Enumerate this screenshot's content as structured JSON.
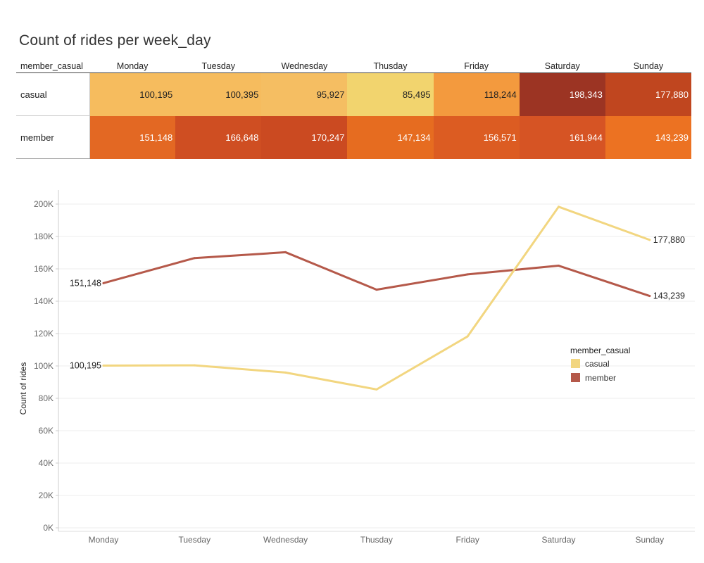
{
  "title": "Count of rides per week_day",
  "table": {
    "corner_label": "member_casual",
    "columns": [
      "Monday",
      "Tuesday",
      "Wednesday",
      "Thusday",
      "Friday",
      "Saturday",
      "Sunday"
    ],
    "rows": [
      {
        "label": "casual",
        "values": [
          "100,195",
          "100,395",
          "95,927",
          "85,495",
          "118,244",
          "198,343",
          "177,880"
        ],
        "colors": [
          "#f6bc5e",
          "#f6bc5e",
          "#f5be62",
          "#f2d46e",
          "#f39a3e",
          "#9c3423",
          "#c0461f"
        ],
        "text_colors": [
          "#222222",
          "#222222",
          "#222222",
          "#222222",
          "#222222",
          "#ffffff",
          "#ffffff"
        ]
      },
      {
        "label": "member",
        "values": [
          "151,148",
          "166,648",
          "170,247",
          "147,134",
          "156,571",
          "161,944",
          "143,239"
        ],
        "colors": [
          "#e36823",
          "#cf4e22",
          "#cb4a21",
          "#e66c20",
          "#dc5c22",
          "#d65424",
          "#ec7222"
        ],
        "text_colors": [
          "#ffffff",
          "#ffffff",
          "#ffffff",
          "#ffffff",
          "#ffffff",
          "#ffffff",
          "#ffffff"
        ]
      }
    ]
  },
  "chart_data": {
    "type": "line",
    "x": [
      "Monday",
      "Tuesday",
      "Wednesday",
      "Thusday",
      "Friday",
      "Saturday",
      "Sunday"
    ],
    "series": [
      {
        "name": "casual",
        "color": "#f2d680",
        "values": [
          100195,
          100395,
          95927,
          85495,
          118244,
          198343,
          177880
        ]
      },
      {
        "name": "member",
        "color": "#b5594a",
        "values": [
          151148,
          166648,
          170247,
          147134,
          156571,
          161944,
          143239
        ]
      }
    ],
    "ylabel": "Count of rides",
    "xlabel": "",
    "ylim": [
      0,
      200000
    ],
    "yticks": [
      0,
      20000,
      40000,
      60000,
      80000,
      100000,
      120000,
      140000,
      160000,
      180000,
      200000
    ],
    "ytick_labels": [
      "0K",
      "20K",
      "40K",
      "60K",
      "80K",
      "100K",
      "120K",
      "140K",
      "160K",
      "180K",
      "200K"
    ],
    "end_labels": {
      "casual": {
        "first": "100,195",
        "last": "177,880"
      },
      "member": {
        "first": "151,148",
        "last": "143,239"
      }
    },
    "grid": true,
    "legend": {
      "title": "member_casual",
      "position": "right"
    }
  }
}
